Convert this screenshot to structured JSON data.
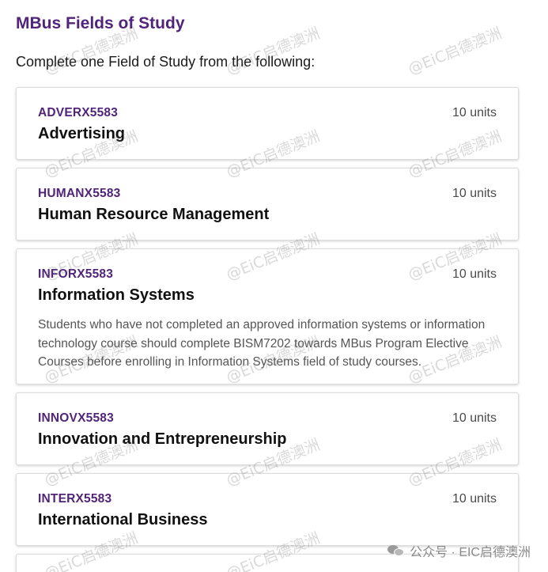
{
  "heading": "MBus Fields of Study",
  "intro": "Complete one Field of Study from the following:",
  "fields": [
    {
      "code": "ADVERX5583",
      "units": "10 units",
      "name": "Advertising",
      "description": ""
    },
    {
      "code": "HUMANX5583",
      "units": "10 units",
      "name": "Human Resource Management",
      "description": ""
    },
    {
      "code": "INFORX5583",
      "units": "10 units",
      "name": "Information Systems",
      "description": "Students who have not completed an approved information systems or information technology course should complete BISM7202 towards MBus Program Elective Courses before enrolling in Information Systems field of study courses."
    },
    {
      "code": "INNOVX5583",
      "units": "10 units",
      "name": "Innovation and Entrepreneurship",
      "description": ""
    },
    {
      "code": "INTERX5583",
      "units": "10 units",
      "name": "International Business",
      "description": ""
    }
  ],
  "watermark_text": "@EiC启德澳洲",
  "footer_watermark": "公众号 · EIC启德澳洲",
  "colors": {
    "accent": "#51247a",
    "muted": "#555555"
  }
}
